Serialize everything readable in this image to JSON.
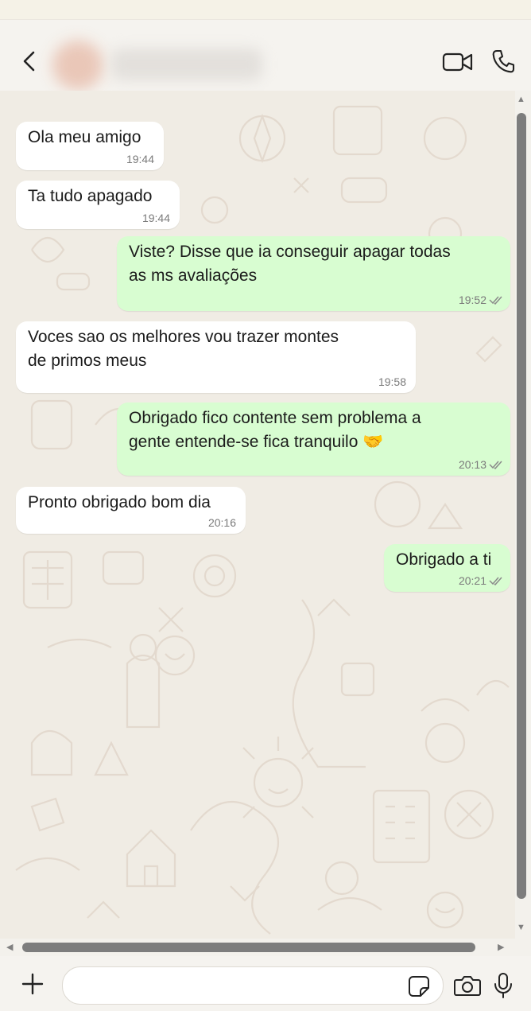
{
  "header": {
    "back_icon": "chevron-left-icon",
    "video_icon": "video-camera-icon",
    "call_icon": "phone-icon"
  },
  "messages": [
    {
      "direction": "in",
      "text": "Ola meu amigo",
      "time": "19:44"
    },
    {
      "direction": "in",
      "text": "Ta tudo apagado",
      "time": "19:44"
    },
    {
      "direction": "out",
      "text": "Viste? Disse que ia conseguir apagar todas\nas ms avaliações",
      "time": "19:52"
    },
    {
      "direction": "in",
      "text": "Voces sao os melhores vou trazer montes\nde primos meus",
      "time": "19:58"
    },
    {
      "direction": "out",
      "text": "Obrigado fico contente sem problema a\ngente entende-se fica tranquilo 🤝",
      "time": "20:13"
    },
    {
      "direction": "in",
      "text": "Pronto obrigado bom dia",
      "time": "20:16"
    },
    {
      "direction": "out",
      "text": "Obrigado a ti",
      "time": "20:21"
    }
  ],
  "composer": {
    "placeholder": "",
    "value": "",
    "icons": [
      "plus-icon",
      "sticker-icon",
      "camera-icon",
      "microphone-icon"
    ]
  },
  "colors": {
    "incoming_bubble": "#ffffff",
    "outgoing_bubble": "#d8fdd1",
    "chat_background": "#f0ece4",
    "read_ticks": "#8a8a8a"
  }
}
